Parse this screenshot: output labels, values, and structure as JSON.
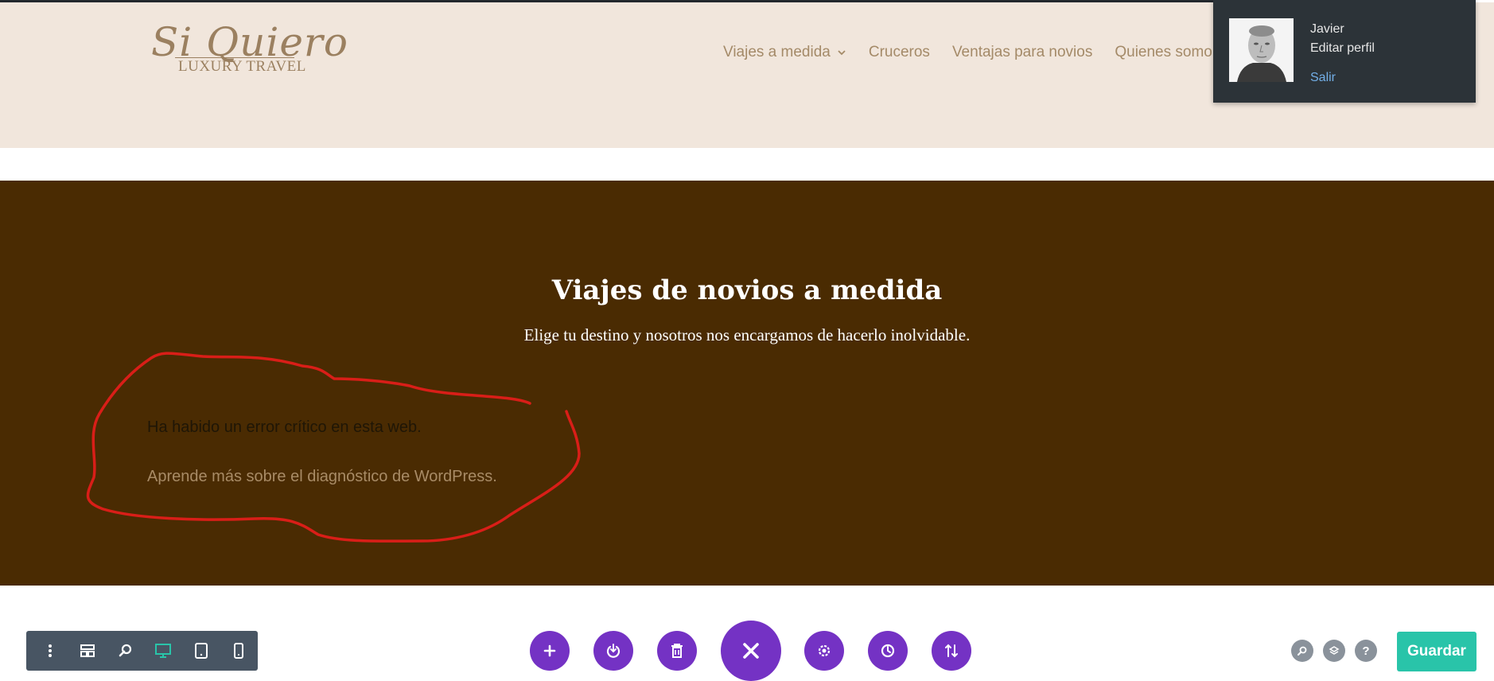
{
  "logo": {
    "script_text": "Si Quiero",
    "subtitle": "LUXURY TRAVEL"
  },
  "nav": {
    "items": [
      {
        "label": "Viajes a medida",
        "has_dropdown": true
      },
      {
        "label": "Cruceros"
      },
      {
        "label": "Ventajas para novios"
      },
      {
        "label": "Quienes somo"
      }
    ]
  },
  "user_panel": {
    "name": "Javier",
    "edit_profile": "Editar perfil",
    "logout": "Salir"
  },
  "hero": {
    "title": "Viajes de novios a medida",
    "subtitle": "Elige tu destino y nosotros nos encargamos de hacerlo inolvidable.",
    "error_message": "Ha habido un error crítico en esta web.",
    "error_link": "Aprende más sobre el diagnóstico de WordPress."
  },
  "builder_toolbar_left": {
    "icons": [
      "dots-vertical-icon",
      "layout-icon",
      "zoom-icon",
      "desktop-icon",
      "tablet-icon",
      "phone-icon"
    ]
  },
  "builder_toolbar_center": {
    "icons": [
      "plus-icon",
      "power-icon",
      "trash-icon",
      "close-icon",
      "gear-icon",
      "history-icon",
      "sort-icon"
    ]
  },
  "builder_toolbar_right": {
    "icons": [
      "search-icon",
      "layers-icon"
    ],
    "help_label": "?",
    "save_label": "Guardar"
  },
  "colors": {
    "header_bg": "#f1e6dc",
    "hero_bg": "#4a2b02",
    "nav_text": "#a48a68",
    "builder_purple": "#7432c4",
    "save_green": "#29c4a9",
    "panel_bg": "#2c3338",
    "annotation_red": "#d91e18"
  }
}
